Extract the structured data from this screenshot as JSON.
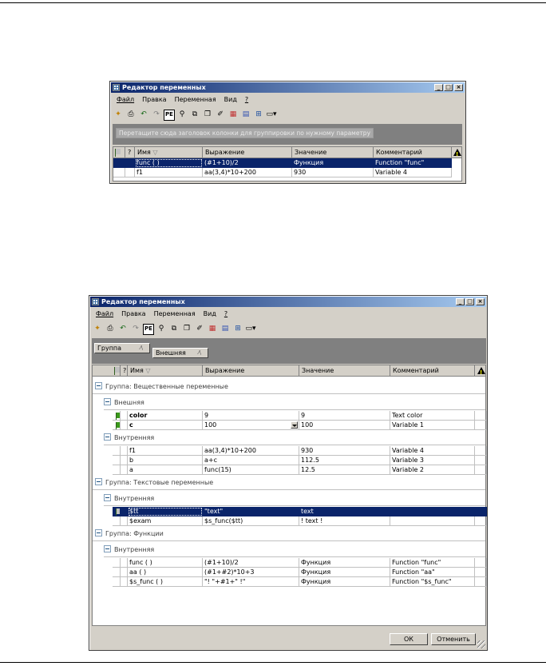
{
  "window1": {
    "title": "Редактор переменных",
    "menu": [
      "Файл",
      "Правка",
      "Переменная",
      "Вид",
      "?"
    ],
    "group_hint": "Перетащите сюда заголовок колонки для группировки по нужному параметру",
    "columns": [
      "?",
      "Имя",
      "Выражение",
      "Значение",
      "Комментарий"
    ],
    "rows": [
      {
        "name": "func ( )",
        "expr": "(#1+10)/2",
        "value": "Функция",
        "comment": "Function \"func\"",
        "selected": true
      },
      {
        "name": "f1",
        "expr": "aa(3,4)*10+200",
        "value": "930",
        "comment": "Variable 4",
        "selected": false
      }
    ]
  },
  "window2": {
    "title": "Редактор переменных",
    "menu": [
      "Файл",
      "Правка",
      "Переменная",
      "Вид",
      "?"
    ],
    "group_chips": [
      "Группа",
      "Внешняя"
    ],
    "columns": [
      "?",
      "Имя",
      "Выражение",
      "Значение",
      "Комментарий"
    ],
    "groups": [
      {
        "label": "Группа: Вещественные переменные",
        "sub": [
          {
            "label": "Внешняя",
            "rows": [
              {
                "flag": "green",
                "name": "color",
                "expr": "9",
                "value": "9",
                "comment": "Text color",
                "bold": true
              },
              {
                "flag": "green",
                "name": "c",
                "expr": "100",
                "value": "100",
                "comment": "Variable 1",
                "bold": true,
                "dropdown": true
              }
            ]
          },
          {
            "label": "Внутренняя",
            "rows": [
              {
                "flag": "",
                "name": "f1",
                "expr": "aa(3,4)*10+200",
                "value": "930",
                "comment": "Variable 4"
              },
              {
                "flag": "",
                "name": "b",
                "expr": "a+c",
                "value": "112.5",
                "comment": "Variable 3"
              },
              {
                "flag": "",
                "name": "a",
                "expr": "func(15)",
                "value": "12.5",
                "comment": "Variable 2"
              }
            ]
          }
        ]
      },
      {
        "label": "Группа: Текстовые переменные",
        "sub": [
          {
            "label": "Внутренняя",
            "rows": [
              {
                "flag": "grey",
                "name": "$tt",
                "expr": "\"text\"",
                "value": "text",
                "comment": "",
                "selected": true
              },
              {
                "flag": "",
                "name": "$exam",
                "expr": "$s_func($tt)",
                "value": "! text !",
                "comment": ""
              }
            ]
          }
        ]
      },
      {
        "label": "Группа: Функции",
        "sub": [
          {
            "label": "Внутренняя",
            "rows": [
              {
                "flag": "",
                "name": "func ( )",
                "expr": "(#1+10)/2",
                "value": "Функция",
                "comment": "Function \"func\""
              },
              {
                "flag": "",
                "name": "aa ( )",
                "expr": "(#1+#2)*10+3",
                "value": "Функция",
                "comment": "Function \"aa\""
              },
              {
                "flag": "",
                "name": "$s_func ( )",
                "expr": "\"! \"+#1+\" !\"",
                "value": "Функция",
                "comment": "Function \"$s_func\""
              }
            ]
          }
        ]
      }
    ],
    "ok_label": "ОК",
    "cancel_label": "Отменить"
  },
  "icons": [
    "window-icon",
    "new-var-icon",
    "print-icon",
    "undo-icon",
    "redo-icon",
    "pe-icon",
    "find-icon",
    "copy-icon",
    "paste-icon",
    "properties-icon",
    "grid-icon",
    "tree-icon",
    "var-icon",
    "view-icon"
  ]
}
